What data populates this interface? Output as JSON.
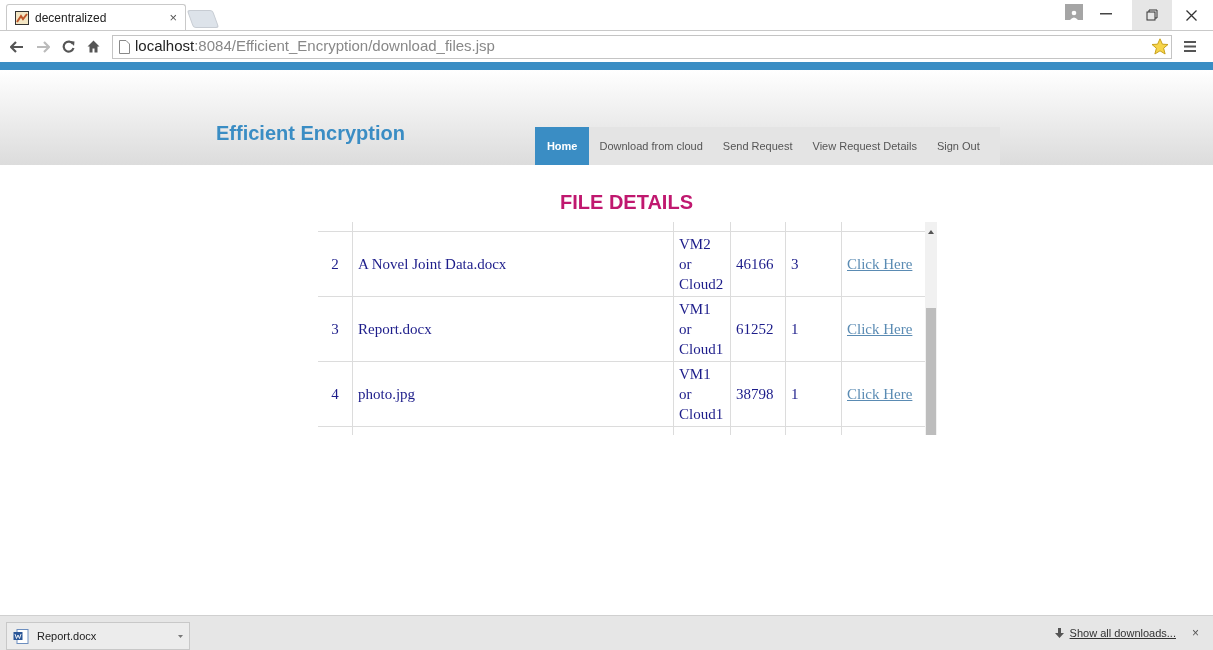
{
  "browser": {
    "tab": {
      "title": "decentralized",
      "close": "×"
    },
    "address": {
      "host": "localhost",
      "path": ":8084/Efficient_Encryption/download_files.jsp"
    }
  },
  "site": {
    "title": "Efficient Encryption",
    "nav": [
      {
        "label": "Home",
        "selected": true
      },
      {
        "label": "Download from cloud",
        "selected": false
      },
      {
        "label": "Send Request",
        "selected": false
      },
      {
        "label": "View Request Details",
        "selected": false
      },
      {
        "label": "Sign Out",
        "selected": false
      }
    ]
  },
  "heading": "FILE DETAILS",
  "table": {
    "rows": [
      {
        "number": "2",
        "file": "A Novel Joint Data.docx",
        "location": [
          "VM2",
          "or",
          "Cloud2"
        ],
        "size": "46166",
        "column_5": "3",
        "link": "Click Here"
      },
      {
        "number": "3",
        "file": "Report.docx",
        "location": [
          "VM1",
          "or",
          "Cloud1"
        ],
        "size": "61252",
        "column_5": "1",
        "link": "Click Here"
      },
      {
        "number": "4",
        "file": "photo.jpg",
        "location": [
          "VM1",
          "or",
          "Cloud1"
        ],
        "size": "38798",
        "column_5": "1",
        "link": "Click Here"
      }
    ]
  },
  "download_bar": {
    "item": "Report.docx",
    "show_all": "Show all downloads...",
    "close": "×"
  }
}
